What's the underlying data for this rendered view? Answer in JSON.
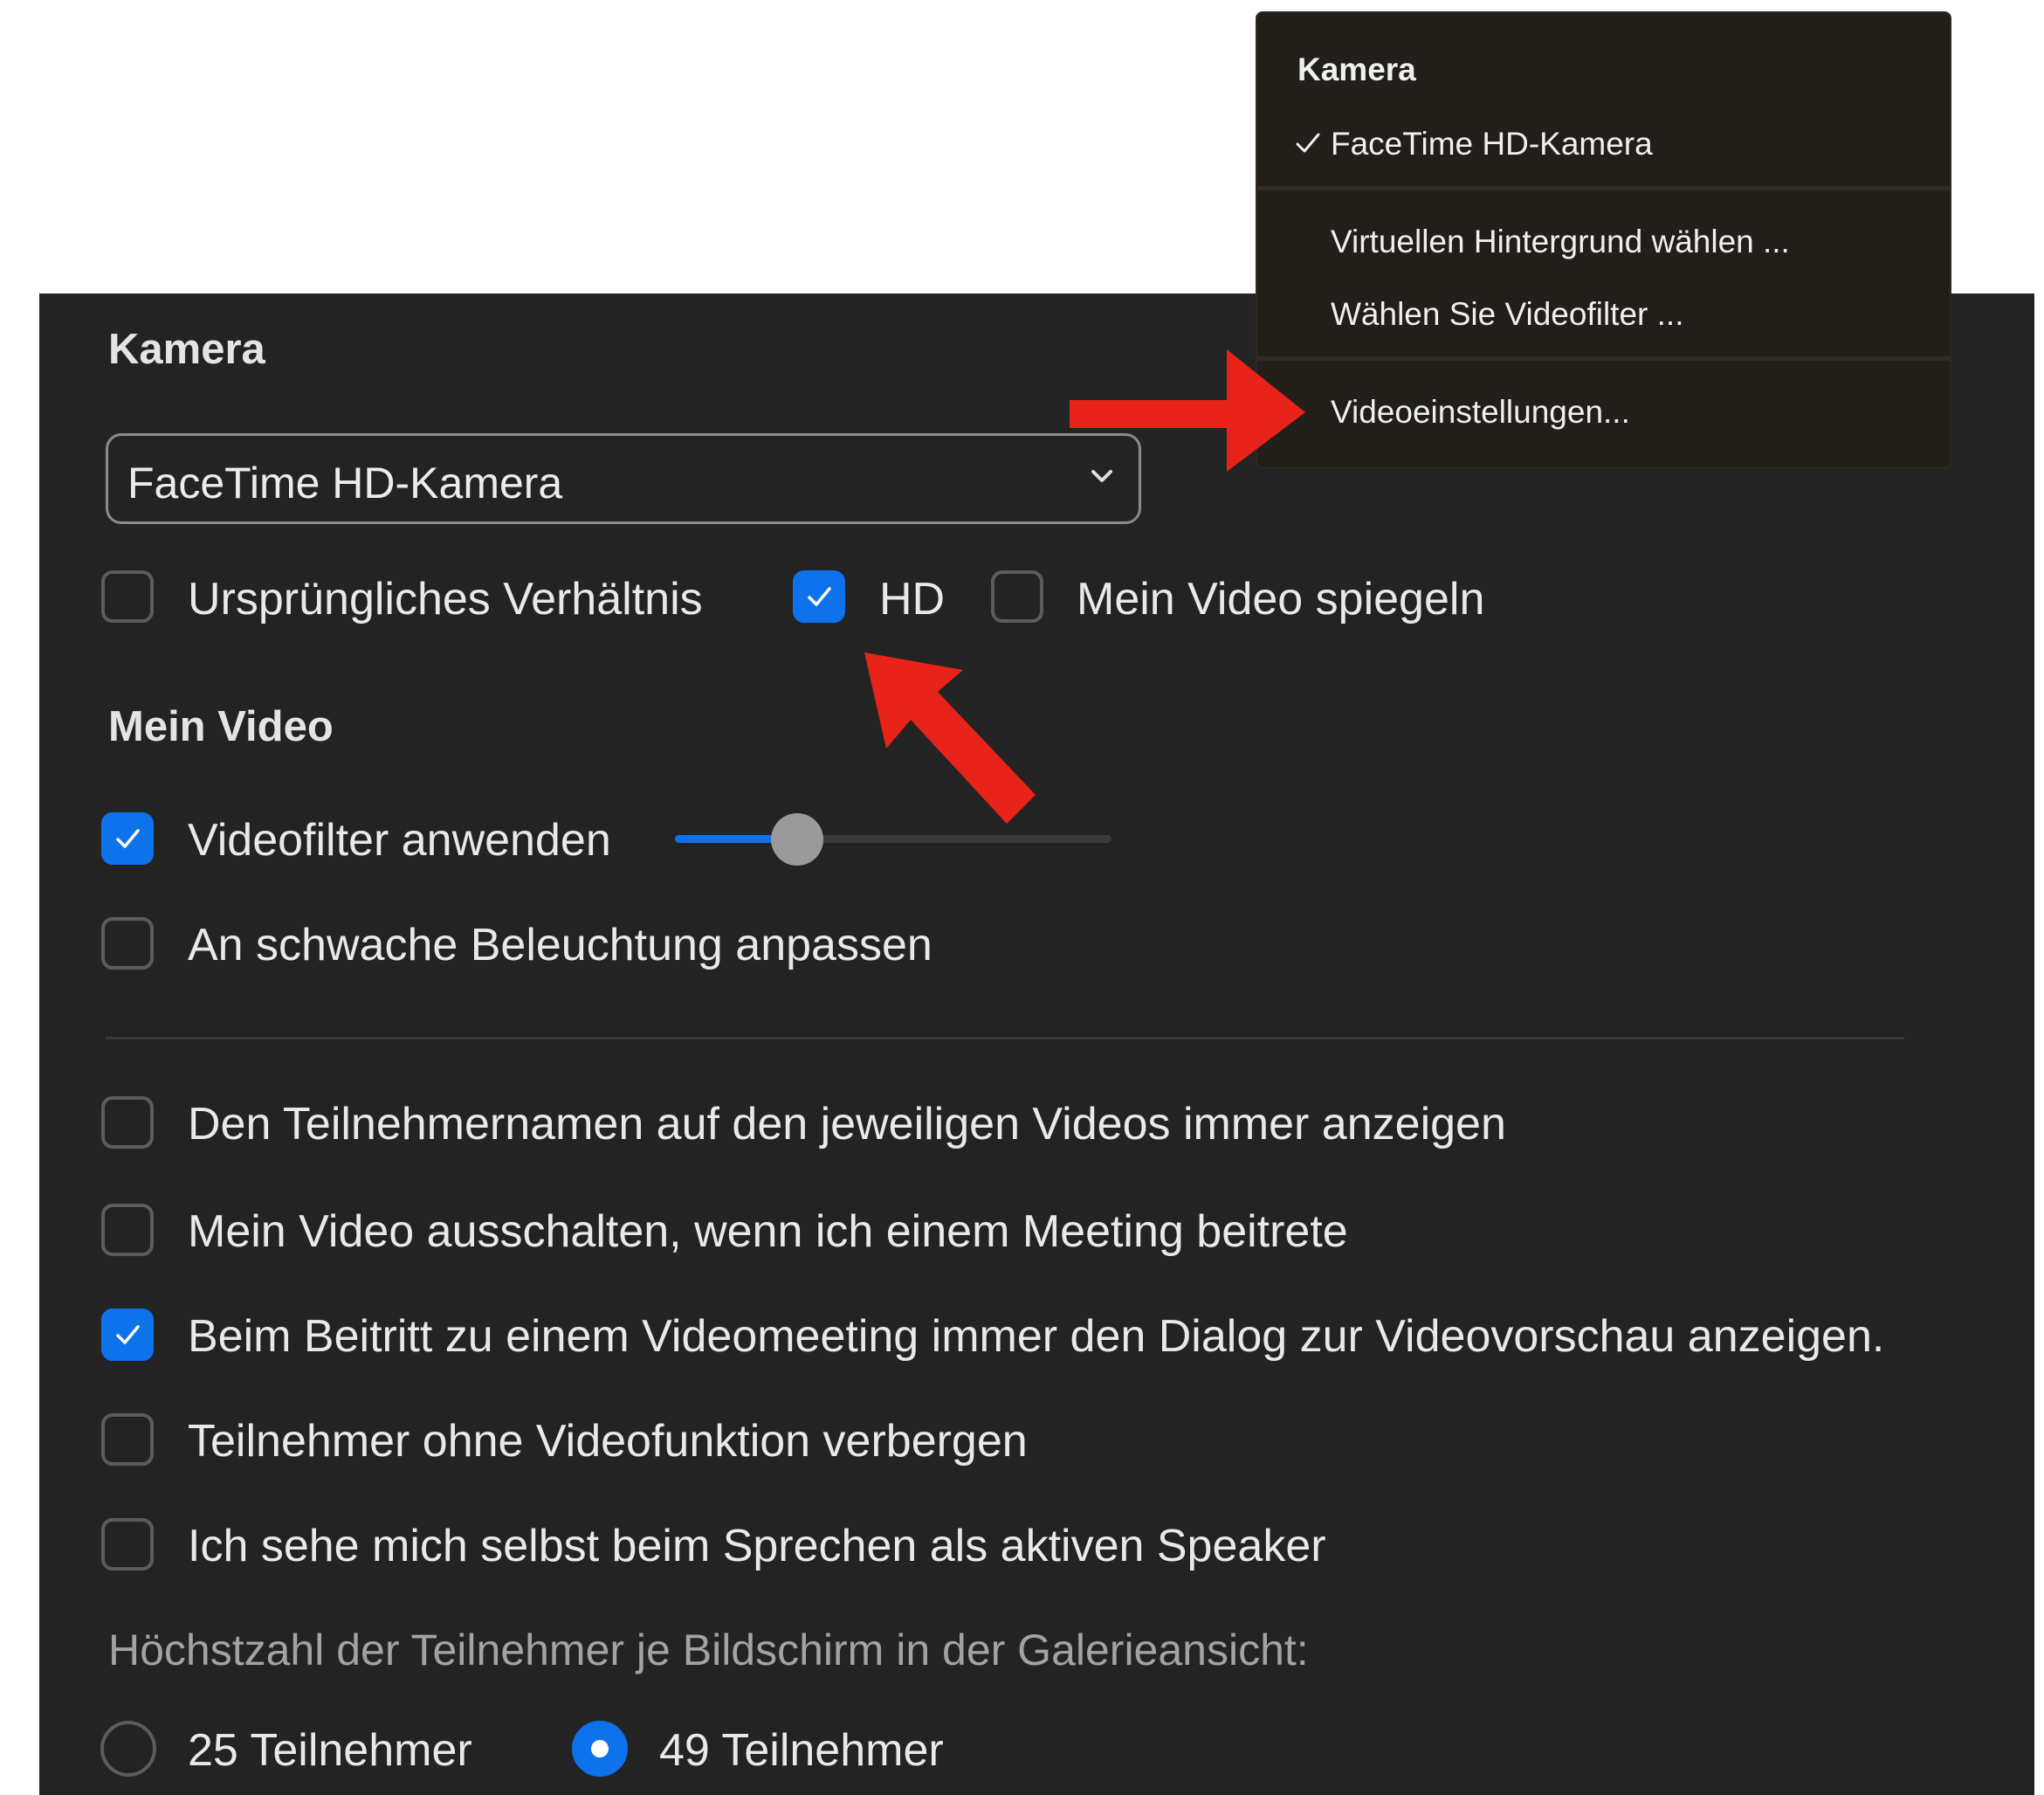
{
  "panel": {
    "camera_heading": "Kamera",
    "camera_select_value": "FaceTime HD-Kamera",
    "options_row": [
      {
        "label": "Ursprüngliches Verhältnis",
        "checked": false
      },
      {
        "label": "HD",
        "checked": true
      },
      {
        "label": "Mein Video spiegeln",
        "checked": false
      }
    ],
    "my_video_heading": "Mein Video",
    "video_filter": {
      "label": "Videofilter anwenden",
      "checked": true,
      "slider_level": 0.28
    },
    "low_light": {
      "label": "An schwache Beleuchtung anpassen",
      "checked": false
    },
    "checkboxes": [
      {
        "label": "Den Teilnehmernamen auf den jeweiligen Videos immer anzeigen",
        "checked": false
      },
      {
        "label": "Mein Video ausschalten, wenn ich einem Meeting beitrete",
        "checked": false
      },
      {
        "label": "Beim Beitritt zu einem Videomeeting immer den Dialog zur Videovorschau anzeigen.",
        "checked": true
      },
      {
        "label": "Teilnehmer ohne Videofunktion verbergen",
        "checked": false
      },
      {
        "label": "Ich sehe mich selbst beim Sprechen als aktiven Speaker",
        "checked": false
      }
    ],
    "gallery_heading": "Höchstzahl der Teilnehmer je Bildschirm in der Galerieansicht:",
    "gallery_options": [
      {
        "label": "25 Teilnehmer",
        "selected": false
      },
      {
        "label": "49 Teilnehmer",
        "selected": true
      }
    ]
  },
  "menu": {
    "title": "Kamera",
    "items": [
      {
        "label": "FaceTime HD-Kamera",
        "checked": true
      },
      {
        "label": "Virtuellen Hintergrund wählen ..."
      },
      {
        "label": "Wählen Sie Videofilter ..."
      },
      {
        "label": "Videoeinstellungen..."
      }
    ]
  },
  "colors": {
    "accent": "#0e72ed",
    "panel_background": "#232323",
    "menu_background": "#221e19",
    "annotation_arrow": "#e8231a"
  },
  "icons": [
    "checkmark-icon",
    "chevron-down-icon",
    "annotation-arrow"
  ]
}
